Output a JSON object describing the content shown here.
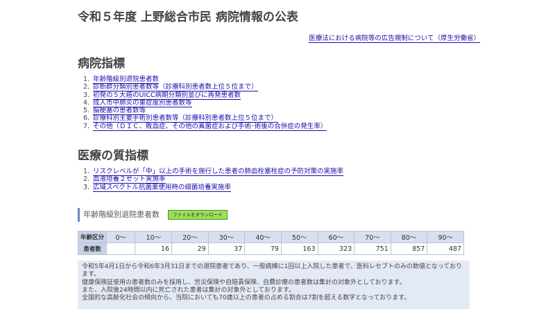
{
  "page": {
    "title": "令和５年度 上野総合市民 病院情報の公表",
    "top_link": "医療法における病院等の広告規制について（厚生労働省）"
  },
  "hospital_indicators": {
    "heading": "病院指標",
    "items": [
      {
        "num": "1.",
        "label": "年齢階級別退院患者数"
      },
      {
        "num": "2.",
        "label": "診断群分類別患者数等（診療科別患者数上位５位まで）"
      },
      {
        "num": "3.",
        "label": "初発の５大癌のUICC病期分類別並びに再発患者数"
      },
      {
        "num": "4.",
        "label": "成人市中肺炎の重症度別患者数等"
      },
      {
        "num": "5.",
        "label": "脳梗塞の患者数等"
      },
      {
        "num": "6.",
        "label": "診療科別主要手術別患者数等（診療科別患者数上位５位まで）"
      },
      {
        "num": "7.",
        "label": "その他（ＤＩＣ、敗血症、その他の真菌症および手術･術後の合併症の発生率）"
      }
    ]
  },
  "quality_indicators": {
    "heading": "医療の質指標",
    "items": [
      {
        "num": "1.",
        "label": "リスクレベルが「中」以上の手術を施行した患者の肺血栓塞栓症の予防対策の実施率"
      },
      {
        "num": "2.",
        "label": "血液培養２セット実施率"
      },
      {
        "num": "3.",
        "label": "広域スペクトル抗菌薬使用時の細菌培養実施率"
      }
    ]
  },
  "age_table": {
    "heading": "年齢階級別退院患者数",
    "download_label": "ファイルをダウンロード",
    "row_header_age": "年齢区分",
    "row_header_count": "患者数",
    "ages": [
      "0～",
      "10～",
      "20～",
      "30～",
      "40～",
      "50～",
      "60～",
      "70～",
      "80～",
      "90～"
    ],
    "counts": [
      "",
      "16",
      "29",
      "37",
      "79",
      "163",
      "323",
      "751",
      "857",
      "487"
    ]
  },
  "note": {
    "lines": [
      "令和5年4月1日から令和6年3月31日までの退院患者であり、一般病棟に1回以上入院した患者で、医科レセプトのみの数値となっております。",
      "健康保険証使用の患者数のみを採用し、労災保険や自賠責保険、自費診療の患者数は集計の対象外としております。",
      "また、入院後24時間以内に死亡された患者は集計の対象外としております。",
      "全国的な高齢化社会の傾向から、当院においても70歳以上の患者の占める割合は7割を超える数字となっております。"
    ]
  },
  "colors": {
    "link": "#1a0dab",
    "table_header_bg": "#d7e0ee",
    "note_bg": "#e4eaf5",
    "download_button_bg": "#9be05a"
  }
}
